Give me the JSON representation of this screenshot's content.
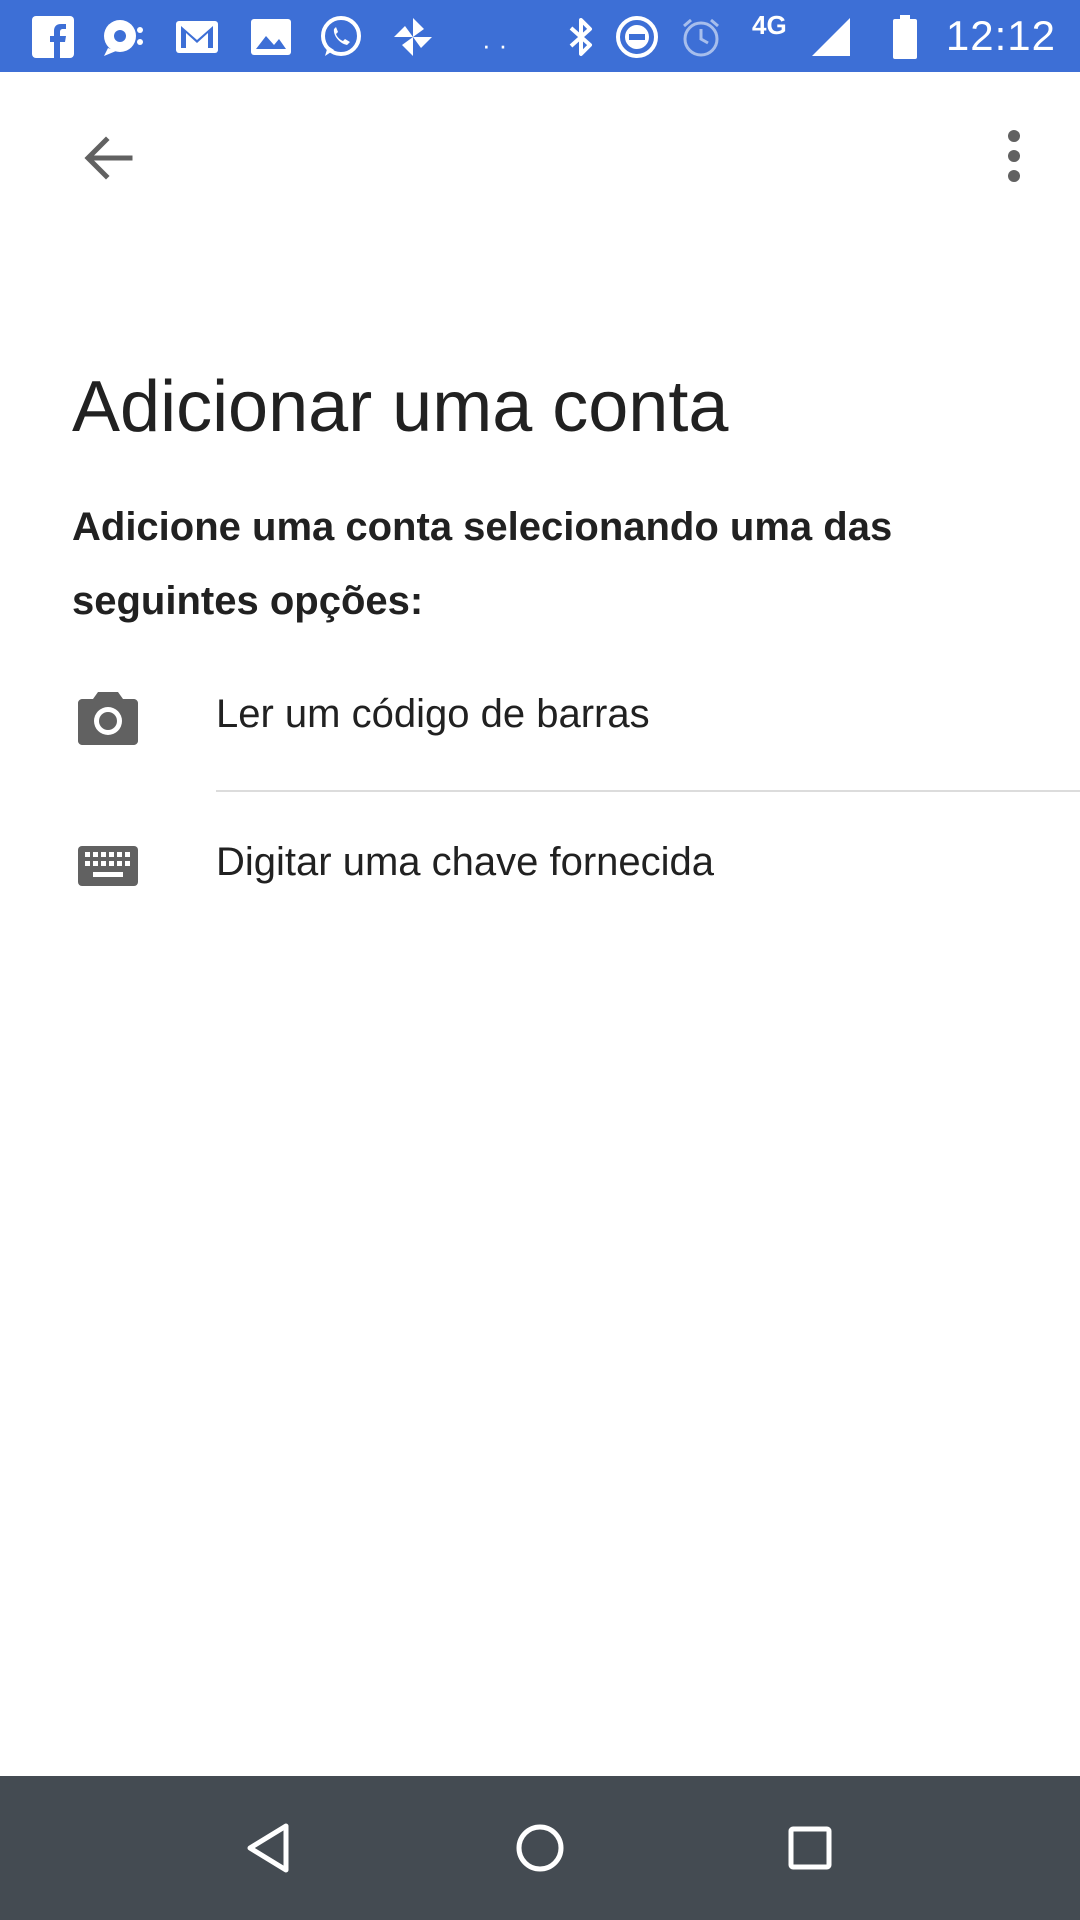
{
  "status_bar": {
    "time": "12:12",
    "network": "4G",
    "background": "#3d6fd6",
    "notification_icons": [
      "facebook-icon",
      "chat-icon",
      "gmail-icon",
      "gallery-icon",
      "whatsapp-icon",
      "pinwheel-icon"
    ],
    "system_icons": [
      "bluetooth-icon",
      "do-not-disturb-icon",
      "alarm-icon",
      "signal-icon",
      "battery-icon"
    ],
    "more": "··"
  },
  "app_bar": {
    "back_icon": "arrow-back-icon",
    "menu_icon": "more-vert-icon"
  },
  "page": {
    "title": "Adicionar uma conta",
    "subtitle": "Adicione uma conta selecionando uma das seguintes opções:"
  },
  "options": [
    {
      "icon": "camera-icon",
      "label": "Ler um código de barras"
    },
    {
      "icon": "keyboard-icon",
      "label": "Digitar uma chave fornecida"
    }
  ],
  "nav_bar": {
    "background": "#444b52",
    "buttons": [
      "back-triangle-icon",
      "home-circle-icon",
      "recents-square-icon"
    ]
  }
}
